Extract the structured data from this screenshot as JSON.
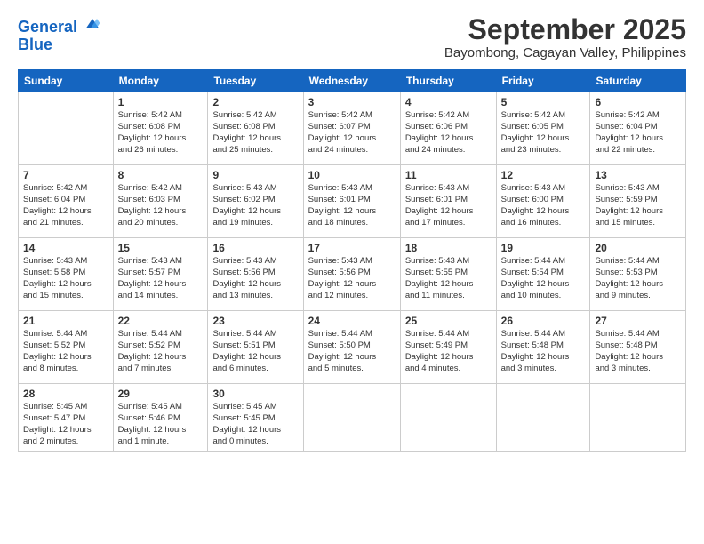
{
  "header": {
    "logo_line1": "General",
    "logo_line2": "Blue",
    "month": "September 2025",
    "location": "Bayombong, Cagayan Valley, Philippines"
  },
  "weekdays": [
    "Sunday",
    "Monday",
    "Tuesday",
    "Wednesday",
    "Thursday",
    "Friday",
    "Saturday"
  ],
  "weeks": [
    [
      {
        "day": "",
        "text": ""
      },
      {
        "day": "1",
        "text": "Sunrise: 5:42 AM\nSunset: 6:08 PM\nDaylight: 12 hours\nand 26 minutes."
      },
      {
        "day": "2",
        "text": "Sunrise: 5:42 AM\nSunset: 6:08 PM\nDaylight: 12 hours\nand 25 minutes."
      },
      {
        "day": "3",
        "text": "Sunrise: 5:42 AM\nSunset: 6:07 PM\nDaylight: 12 hours\nand 24 minutes."
      },
      {
        "day": "4",
        "text": "Sunrise: 5:42 AM\nSunset: 6:06 PM\nDaylight: 12 hours\nand 24 minutes."
      },
      {
        "day": "5",
        "text": "Sunrise: 5:42 AM\nSunset: 6:05 PM\nDaylight: 12 hours\nand 23 minutes."
      },
      {
        "day": "6",
        "text": "Sunrise: 5:42 AM\nSunset: 6:04 PM\nDaylight: 12 hours\nand 22 minutes."
      }
    ],
    [
      {
        "day": "7",
        "text": "Sunrise: 5:42 AM\nSunset: 6:04 PM\nDaylight: 12 hours\nand 21 minutes."
      },
      {
        "day": "8",
        "text": "Sunrise: 5:42 AM\nSunset: 6:03 PM\nDaylight: 12 hours\nand 20 minutes."
      },
      {
        "day": "9",
        "text": "Sunrise: 5:43 AM\nSunset: 6:02 PM\nDaylight: 12 hours\nand 19 minutes."
      },
      {
        "day": "10",
        "text": "Sunrise: 5:43 AM\nSunset: 6:01 PM\nDaylight: 12 hours\nand 18 minutes."
      },
      {
        "day": "11",
        "text": "Sunrise: 5:43 AM\nSunset: 6:01 PM\nDaylight: 12 hours\nand 17 minutes."
      },
      {
        "day": "12",
        "text": "Sunrise: 5:43 AM\nSunset: 6:00 PM\nDaylight: 12 hours\nand 16 minutes."
      },
      {
        "day": "13",
        "text": "Sunrise: 5:43 AM\nSunset: 5:59 PM\nDaylight: 12 hours\nand 15 minutes."
      }
    ],
    [
      {
        "day": "14",
        "text": "Sunrise: 5:43 AM\nSunset: 5:58 PM\nDaylight: 12 hours\nand 15 minutes."
      },
      {
        "day": "15",
        "text": "Sunrise: 5:43 AM\nSunset: 5:57 PM\nDaylight: 12 hours\nand 14 minutes."
      },
      {
        "day": "16",
        "text": "Sunrise: 5:43 AM\nSunset: 5:56 PM\nDaylight: 12 hours\nand 13 minutes."
      },
      {
        "day": "17",
        "text": "Sunrise: 5:43 AM\nSunset: 5:56 PM\nDaylight: 12 hours\nand 12 minutes."
      },
      {
        "day": "18",
        "text": "Sunrise: 5:43 AM\nSunset: 5:55 PM\nDaylight: 12 hours\nand 11 minutes."
      },
      {
        "day": "19",
        "text": "Sunrise: 5:44 AM\nSunset: 5:54 PM\nDaylight: 12 hours\nand 10 minutes."
      },
      {
        "day": "20",
        "text": "Sunrise: 5:44 AM\nSunset: 5:53 PM\nDaylight: 12 hours\nand 9 minutes."
      }
    ],
    [
      {
        "day": "21",
        "text": "Sunrise: 5:44 AM\nSunset: 5:52 PM\nDaylight: 12 hours\nand 8 minutes."
      },
      {
        "day": "22",
        "text": "Sunrise: 5:44 AM\nSunset: 5:52 PM\nDaylight: 12 hours\nand 7 minutes."
      },
      {
        "day": "23",
        "text": "Sunrise: 5:44 AM\nSunset: 5:51 PM\nDaylight: 12 hours\nand 6 minutes."
      },
      {
        "day": "24",
        "text": "Sunrise: 5:44 AM\nSunset: 5:50 PM\nDaylight: 12 hours\nand 5 minutes."
      },
      {
        "day": "25",
        "text": "Sunrise: 5:44 AM\nSunset: 5:49 PM\nDaylight: 12 hours\nand 4 minutes."
      },
      {
        "day": "26",
        "text": "Sunrise: 5:44 AM\nSunset: 5:48 PM\nDaylight: 12 hours\nand 3 minutes."
      },
      {
        "day": "27",
        "text": "Sunrise: 5:44 AM\nSunset: 5:48 PM\nDaylight: 12 hours\nand 3 minutes."
      }
    ],
    [
      {
        "day": "28",
        "text": "Sunrise: 5:45 AM\nSunset: 5:47 PM\nDaylight: 12 hours\nand 2 minutes."
      },
      {
        "day": "29",
        "text": "Sunrise: 5:45 AM\nSunset: 5:46 PM\nDaylight: 12 hours\nand 1 minute."
      },
      {
        "day": "30",
        "text": "Sunrise: 5:45 AM\nSunset: 5:45 PM\nDaylight: 12 hours\nand 0 minutes."
      },
      {
        "day": "",
        "text": ""
      },
      {
        "day": "",
        "text": ""
      },
      {
        "day": "",
        "text": ""
      },
      {
        "day": "",
        "text": ""
      }
    ]
  ]
}
